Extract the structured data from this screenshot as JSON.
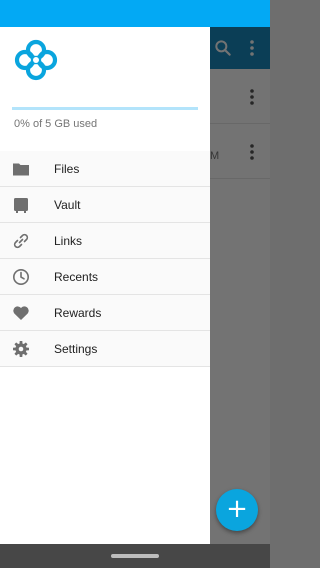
{
  "colors": {
    "status_bar": "#03a9f4",
    "accent": "#03a9f4",
    "storage_track": "#b3e4fb",
    "icon": "#6f6f6f"
  },
  "drawer": {
    "logo": "sync-logo",
    "storage": {
      "text": "0% of 5 GB used",
      "used_fraction": 0.0
    },
    "menu": [
      {
        "label": "Files",
        "icon": "folder-icon"
      },
      {
        "label": "Vault",
        "icon": "vault-icon"
      },
      {
        "label": "Links",
        "icon": "link-icon"
      },
      {
        "label": "Recents",
        "icon": "clock-icon"
      },
      {
        "label": "Rewards",
        "icon": "heart-icon"
      },
      {
        "label": "Settings",
        "icon": "gear-icon"
      }
    ]
  },
  "background": {
    "row_fragment": "M"
  }
}
